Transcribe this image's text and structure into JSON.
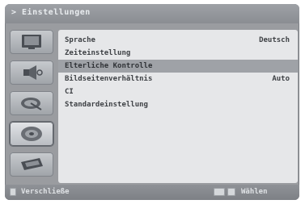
{
  "header": {
    "breadcrumb": "> Einstellungen"
  },
  "sidebar": {
    "icons": [
      {
        "name": "tv-screen-icon"
      },
      {
        "name": "speaker-icon"
      },
      {
        "name": "satellite-dish-icon"
      },
      {
        "name": "disc-icon"
      },
      {
        "name": "remote-control-icon"
      }
    ],
    "selected_index": 3
  },
  "menu": {
    "items": [
      {
        "label": "Sprache",
        "value": "Deutsch"
      },
      {
        "label": "Zeiteinstellung",
        "value": ""
      },
      {
        "label": "Elterliche Kontrolle",
        "value": ""
      },
      {
        "label": "Bildseitenverhältnis",
        "value": "Auto"
      },
      {
        "label": "CI",
        "value": ""
      },
      {
        "label": "Standardeinstellung",
        "value": ""
      }
    ],
    "highlighted_index": 2
  },
  "footer": {
    "close_key_icon": "exit-key-icon",
    "close_label": "Verschließe",
    "nav_key_icon": "ok-key-icon",
    "nav_label": "Wählen"
  }
}
